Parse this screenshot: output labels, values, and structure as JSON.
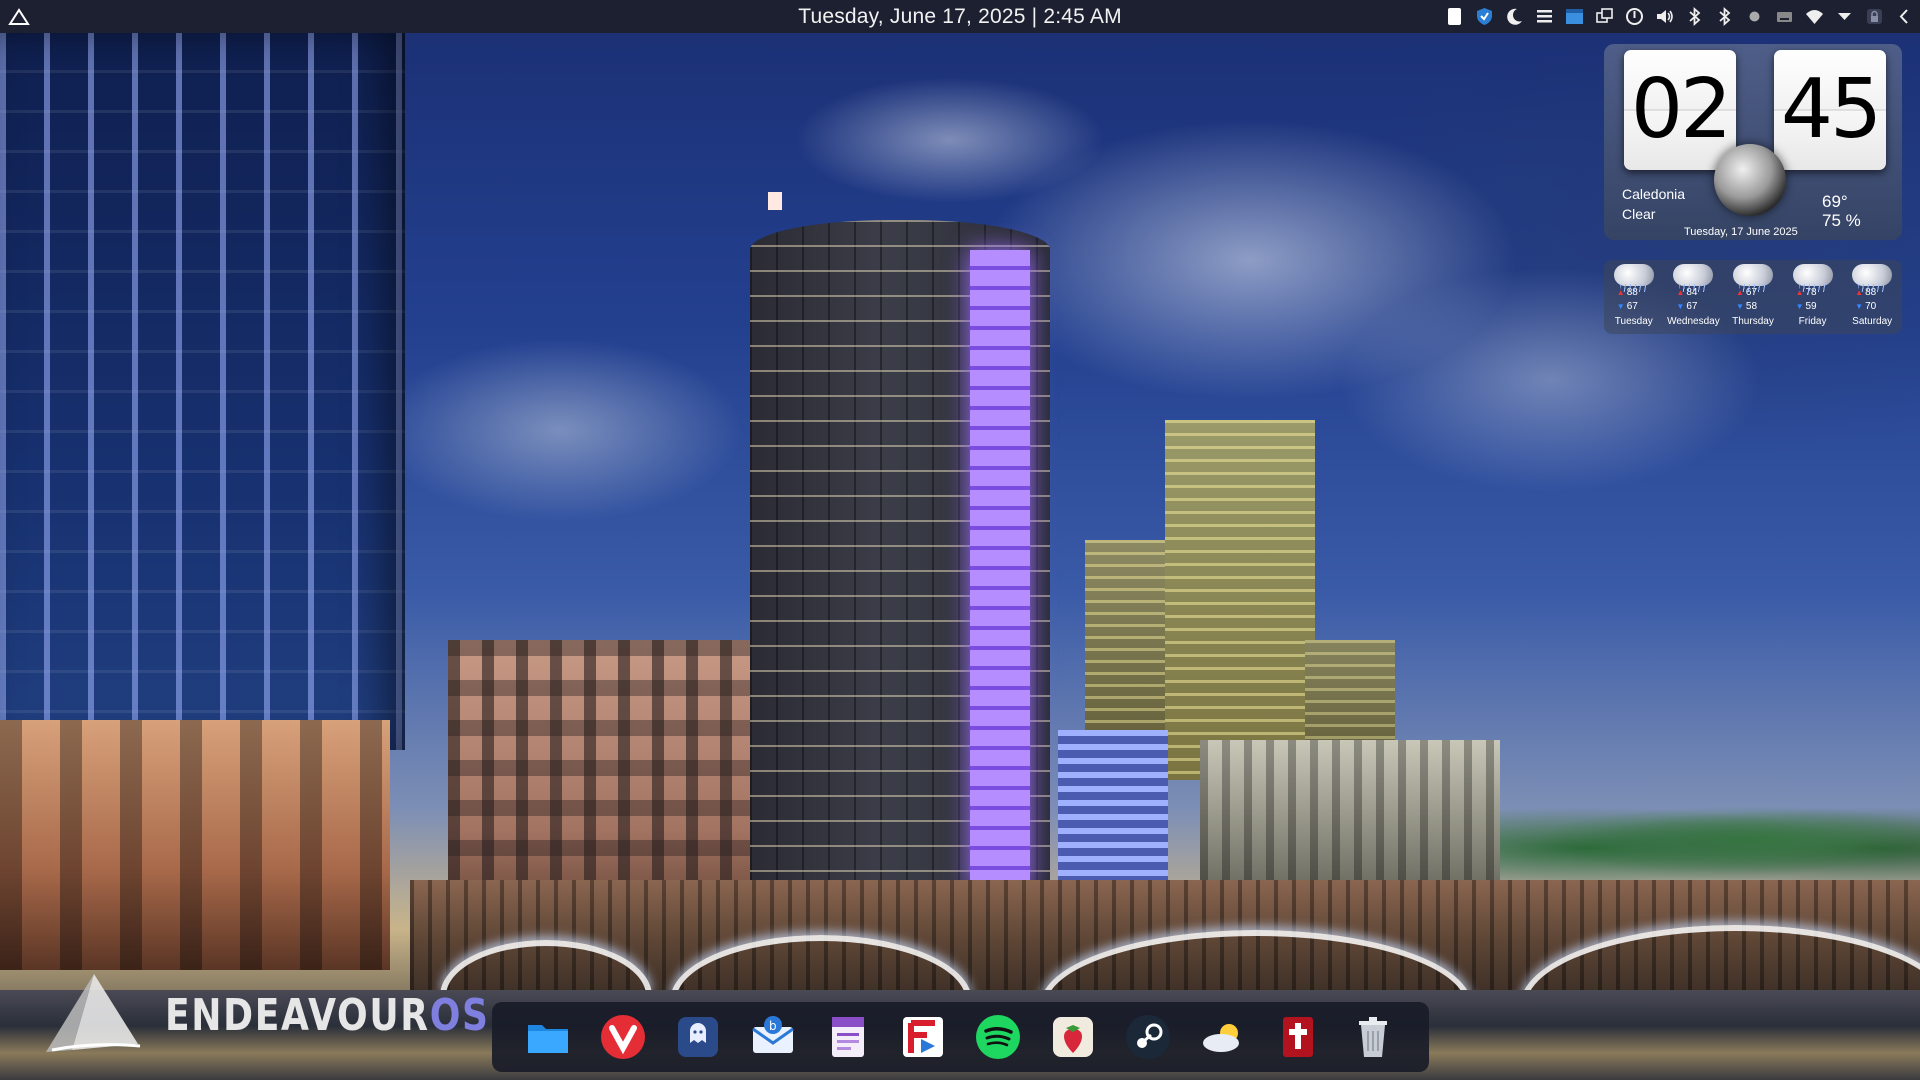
{
  "top_panel": {
    "clock_text": "Tuesday, June 17, 2025 | 2:45 AM",
    "tray_icons": [
      "white-square-icon",
      "shield-icon",
      "moon-icon",
      "list-icon",
      "window-icon",
      "screens-icon",
      "power-icon",
      "volume-icon",
      "bluetooth-icon",
      "bluetooth-icon",
      "brightness-icon",
      "keyboard-icon",
      "wifi-icon",
      "chevron-down-icon",
      "lock-icon",
      "chevron-left-icon"
    ]
  },
  "clock_widget": {
    "hour": "02",
    "minute": "45",
    "location": "Caledonia",
    "condition": "Clear",
    "temperature": "69°",
    "humidity": "75 %",
    "date": "Tuesday, 17 June 2025"
  },
  "forecast": [
    {
      "day": "Tuesday",
      "high": "88",
      "low": "67"
    },
    {
      "day": "Wednesday",
      "high": "84",
      "low": "67"
    },
    {
      "day": "Thursday",
      "high": "67",
      "low": "58"
    },
    {
      "day": "Friday",
      "high": "78",
      "low": "59"
    },
    {
      "day": "Saturday",
      "high": "88",
      "low": "70"
    }
  ],
  "logo": {
    "text_main": "ENDEAVOUR",
    "text_accent": "OS",
    "accent_color": "#7f7fe0"
  },
  "dock": {
    "items": [
      {
        "icon": "files-folder-icon"
      },
      {
        "icon": "vivaldi-browser-icon"
      },
      {
        "icon": "ghost-app-icon"
      },
      {
        "icon": "mail-client-icon"
      },
      {
        "icon": "notes-app-icon"
      },
      {
        "icon": "feed-reader-icon"
      },
      {
        "icon": "spotify-icon"
      },
      {
        "icon": "strawberry-music-icon"
      },
      {
        "icon": "steam-icon"
      },
      {
        "icon": "weather-app-icon"
      },
      {
        "icon": "bible-app-icon"
      },
      {
        "icon": "trash-icon"
      }
    ]
  }
}
